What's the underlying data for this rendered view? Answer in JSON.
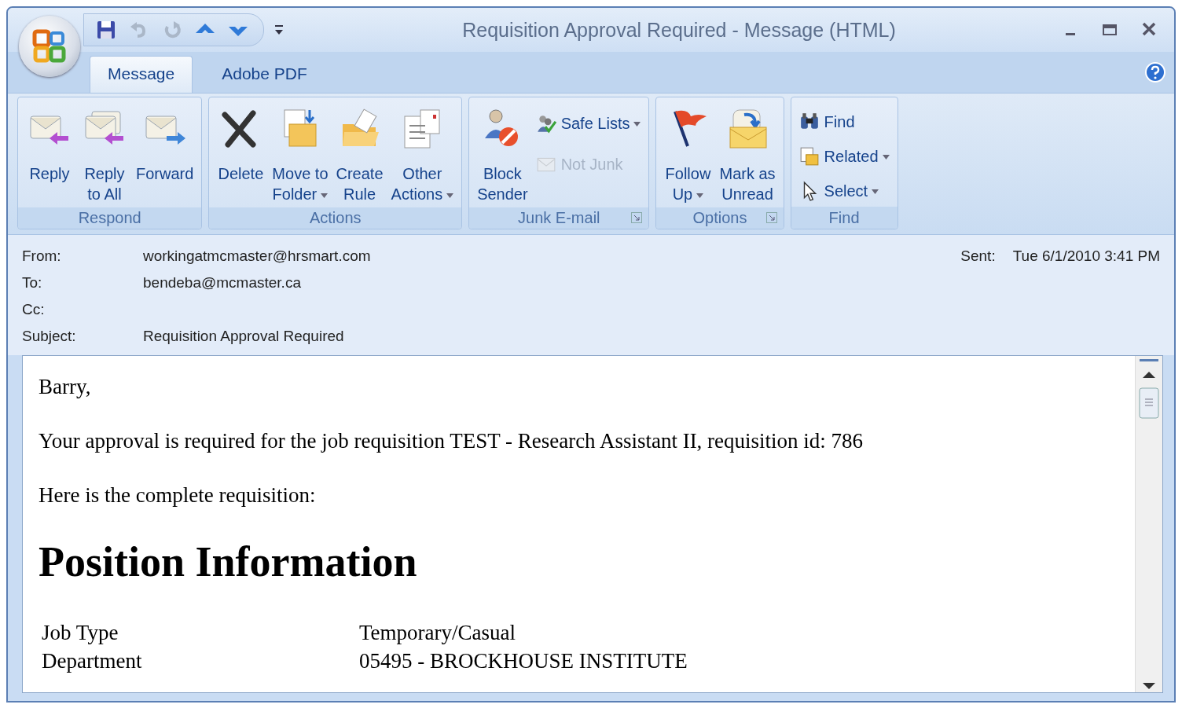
{
  "window": {
    "title": "Requisition Approval Required - Message (HTML)"
  },
  "tabs": [
    {
      "label": "Message",
      "selected": true
    },
    {
      "label": "Adobe PDF",
      "selected": false
    }
  ],
  "ribbon_groups": [
    {
      "name": "Respond",
      "launcher": false,
      "buttons": [
        {
          "kind": "large",
          "lines": [
            "Reply"
          ],
          "dropdown": false,
          "disabled": false
        },
        {
          "kind": "large",
          "lines": [
            "Reply",
            "to All"
          ],
          "dropdown": false,
          "disabled": false
        },
        {
          "kind": "large",
          "lines": [
            "Forward"
          ],
          "dropdown": false,
          "disabled": false
        }
      ]
    },
    {
      "name": "Actions",
      "launcher": false,
      "buttons": [
        {
          "kind": "large",
          "lines": [
            "Delete"
          ],
          "dropdown": false,
          "disabled": false
        },
        {
          "kind": "large",
          "lines": [
            "Move to",
            "Folder"
          ],
          "dropdown": true,
          "disabled": false
        },
        {
          "kind": "large",
          "lines": [
            "Create",
            "Rule"
          ],
          "dropdown": false,
          "disabled": false
        },
        {
          "kind": "large",
          "lines": [
            "Other",
            "Actions"
          ],
          "dropdown": true,
          "disabled": false
        }
      ]
    },
    {
      "name": "Junk E-mail",
      "launcher": true,
      "buttons": [
        {
          "kind": "large",
          "lines": [
            "Block",
            "Sender"
          ],
          "dropdown": false,
          "disabled": false
        },
        {
          "kind": "small",
          "lines": [
            "Safe Lists"
          ],
          "dropdown": true,
          "disabled": false
        },
        {
          "kind": "small",
          "lines": [
            "Not Junk"
          ],
          "dropdown": false,
          "disabled": true
        }
      ]
    },
    {
      "name": "Options",
      "launcher": true,
      "buttons": [
        {
          "kind": "large",
          "lines": [
            "Follow",
            "Up"
          ],
          "dropdown": true,
          "disabled": false
        },
        {
          "kind": "large",
          "lines": [
            "Mark as",
            "Unread"
          ],
          "dropdown": false,
          "disabled": false
        }
      ]
    },
    {
      "name": "Find",
      "launcher": false,
      "buttons": [
        {
          "kind": "small",
          "lines": [
            "Find"
          ],
          "dropdown": false,
          "disabled": false
        },
        {
          "kind": "small",
          "lines": [
            "Related"
          ],
          "dropdown": true,
          "disabled": false
        },
        {
          "kind": "small",
          "lines": [
            "Select"
          ],
          "dropdown": true,
          "disabled": false
        }
      ]
    }
  ],
  "header": {
    "fields": [
      {
        "label": "From:",
        "value": "workingatmcmaster@hrsmart.com"
      },
      {
        "label": "To:",
        "value": "bendeba@mcmaster.ca"
      },
      {
        "label": "Cc:"
      },
      {
        "label": "Subject:",
        "value": "Requisition Approval Required"
      }
    ],
    "sent": {
      "label": "Sent:",
      "value": "Tue 6/1/2010 3:41 PM"
    }
  },
  "body": {
    "paragraphs": [
      "Barry,",
      "Your approval is required for the job requisition TEST - Research Assistant II, requisition id: 786",
      "Here is the complete requisition:"
    ],
    "heading": "Position Information",
    "rows": [
      {
        "label": "Job Type",
        "value": "Temporary/Casual"
      },
      {
        "label": "Department",
        "value": "05495 - BROCKHOUSE INSTITUTE"
      }
    ]
  }
}
